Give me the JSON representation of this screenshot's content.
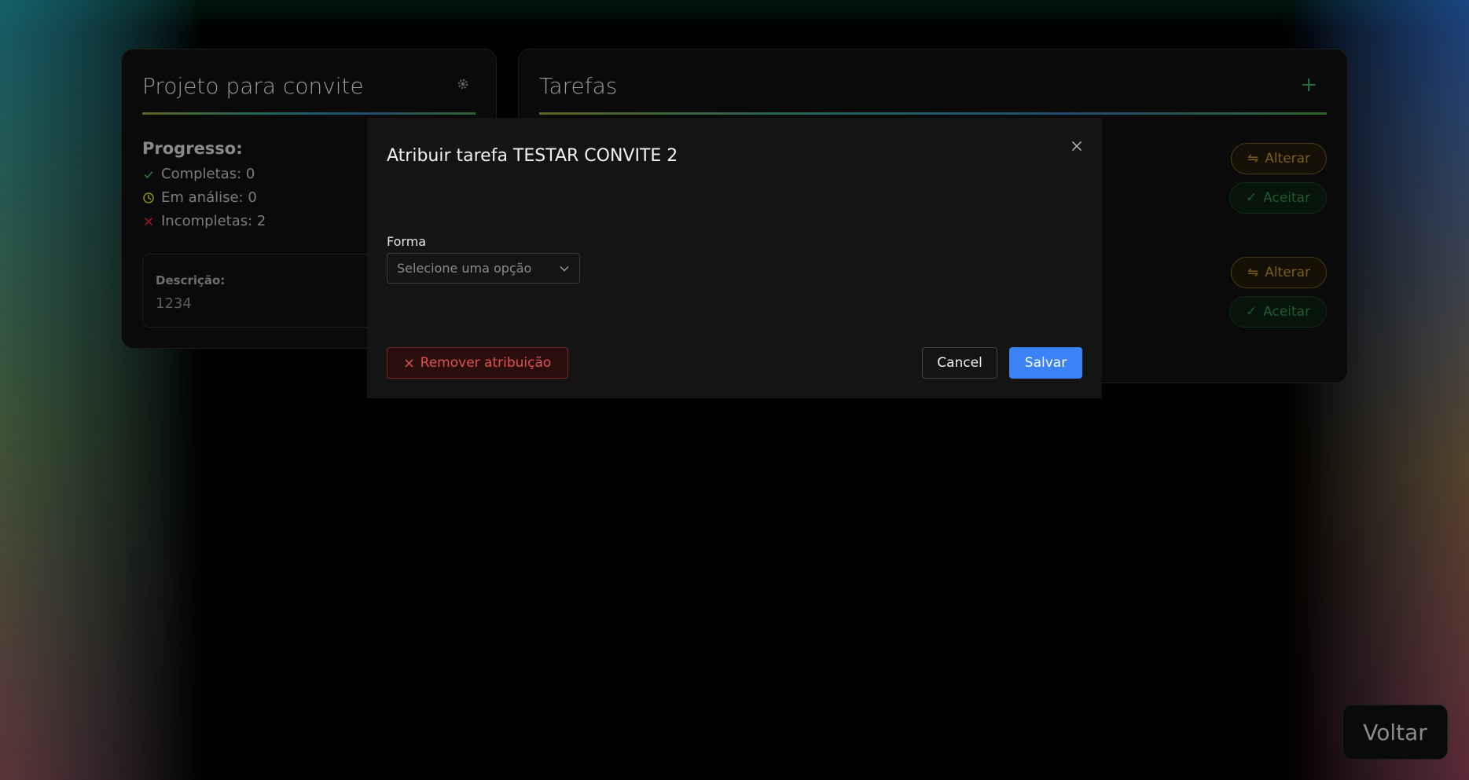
{
  "project_card": {
    "title": "Projeto para convite",
    "progress_label": "Progresso:",
    "completed": "Completas: 0",
    "in_review": "Em análise: 0",
    "incomplete": "Incompletas: 2",
    "description_label": "Descrição:",
    "description_value": "1234"
  },
  "tasks_card": {
    "title": "Tarefas",
    "rows": [
      {
        "change_label": "Alterar",
        "accept_label": "Aceitar"
      },
      {
        "change_label": "Alterar",
        "accept_label": "Aceitar"
      }
    ]
  },
  "modal": {
    "title": "Atribuir tarefa TESTAR CONVITE 2",
    "field_label": "Forma",
    "select_placeholder": "Selecione uma opção",
    "remove_label": "Remover atribuição",
    "cancel_label": "Cancel",
    "save_label": "Salvar"
  },
  "back_label": "Voltar",
  "colors": {
    "primary": "#3b82f6",
    "danger": "#e05050",
    "warning": "#7a5e18",
    "success": "#1f5a34"
  }
}
